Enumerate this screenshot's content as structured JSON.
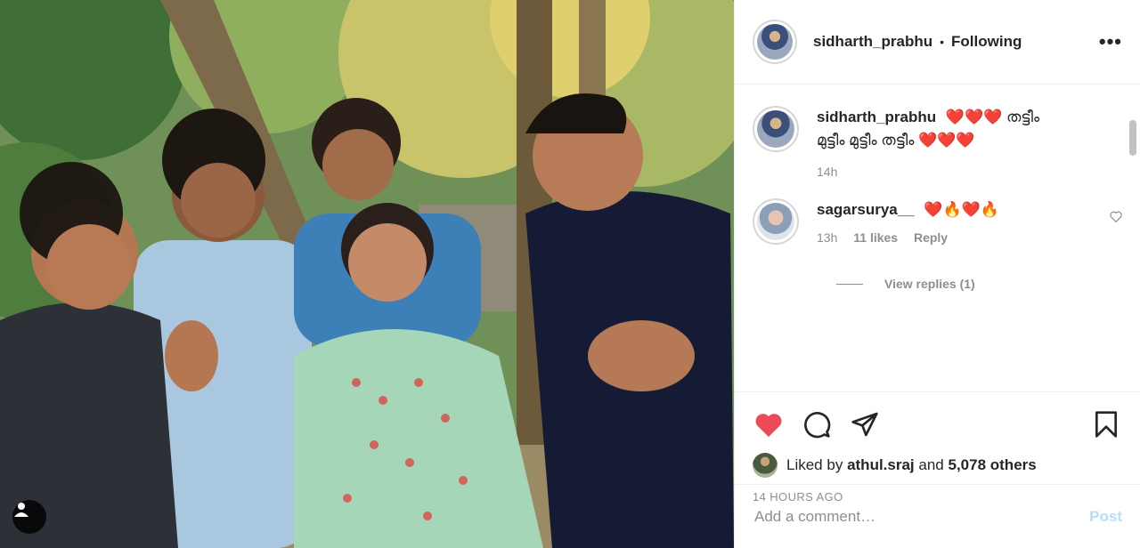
{
  "header": {
    "username": "sidharth_prabhu",
    "separator": "•",
    "follow_status": "Following",
    "more_label": "•••"
  },
  "caption": {
    "username": "sidharth_prabhu",
    "hearts": "❤️❤️❤️",
    "text_line1": "തട്ടീം",
    "text_line2": "മുട്ടീം മുട്ടീം തട്ടീം",
    "hearts2": "❤️❤️❤️",
    "time": "14h"
  },
  "comments": [
    {
      "username": "sagarsurya__",
      "text": "❤️🔥❤️🔥",
      "time": "13h",
      "likes": "11 likes",
      "reply": "Reply"
    }
  ],
  "view_replies": "View replies (1)",
  "likes": {
    "text_prefix": "Liked by ",
    "user": "athul.sraj",
    "text_mid": " and ",
    "others": "5,078 others"
  },
  "timestamp": "14 HOURS AGO",
  "comment_box": {
    "placeholder": "Add a comment…",
    "post_label": "Post"
  },
  "icons": {
    "like": "heart-icon",
    "comment": "comment-icon",
    "share": "paper-plane-icon",
    "save": "bookmark-icon",
    "tag": "user-tag-icon"
  },
  "colors": {
    "like_active": "#ed4956",
    "post_disabled": "#b2dffc",
    "muted": "#8e8e8e"
  }
}
